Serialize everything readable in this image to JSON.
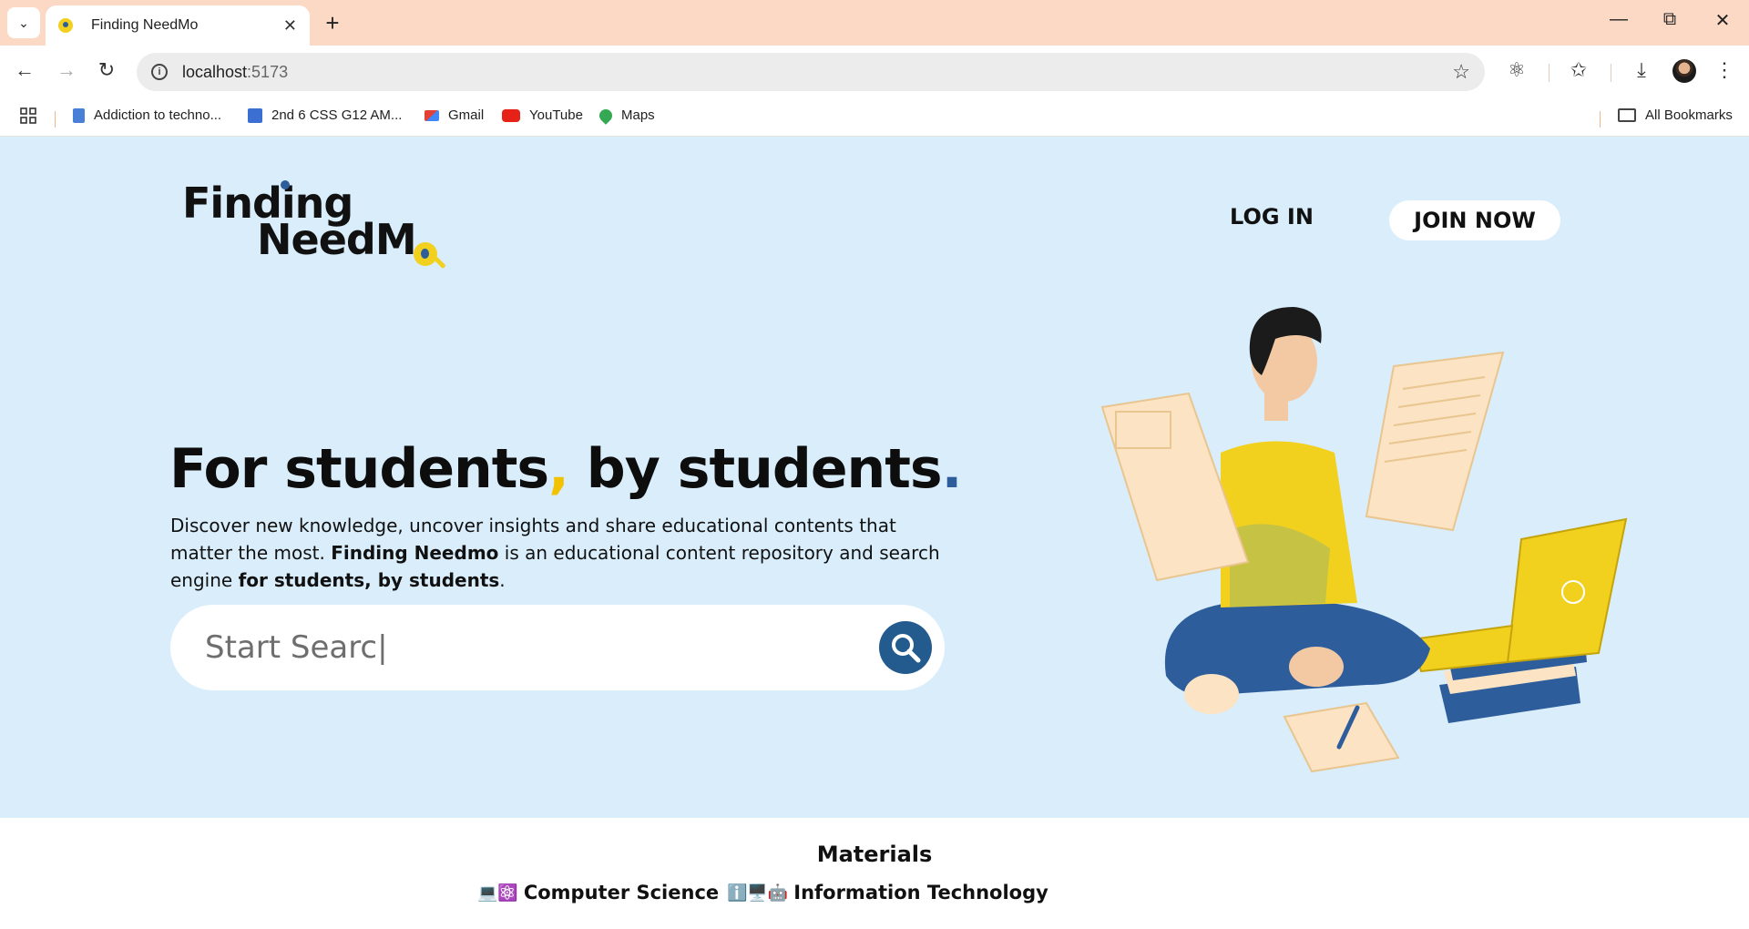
{
  "browser": {
    "tab_title": "Finding NeedMo",
    "tab_close": "✕",
    "new_tab": "+",
    "url_host": "localhost",
    "url_port": ":5173",
    "bookmarks": [
      {
        "label": "Addiction to techno...",
        "color": "#4a7fd8"
      },
      {
        "label": "2nd 6 CSS G12 AM...",
        "color": "#3b6fd1"
      },
      {
        "label": "Gmail",
        "color": "#e44134"
      },
      {
        "label": "YouTube",
        "color": "#e62117"
      },
      {
        "label": "Maps",
        "color": "#34a853"
      }
    ],
    "all_bookmarks": "All Bookmarks"
  },
  "colors": {
    "hero_bg": "#d9edfb",
    "accent_yellow": "#f2c200",
    "accent_blue": "#2e5d9c",
    "search_button": "#235b8f"
  },
  "header": {
    "logo_line1": "Finding",
    "logo_line2": "NeedM",
    "login_label": "LOG IN",
    "join_label": "JOIN NOW"
  },
  "hero": {
    "headline_part1": "For students",
    "headline_comma": ",",
    "headline_part2": " by students",
    "headline_period": ".",
    "desc_1": "Discover new knowledge, uncover insights and share educational contents that matter the most. ",
    "desc_brand": "Finding Needmo",
    "desc_2": " is an educational content repository and search engine ",
    "desc_tagline": "for students, by students",
    "desc_3": ".",
    "search_placeholder": "Start Searc|"
  },
  "materials": {
    "title": "Materials",
    "categories": [
      {
        "emoji": "💻⚛️",
        "label": "Computer Science"
      },
      {
        "emoji": "ℹ️🖥️🤖",
        "label": "Information Technology"
      }
    ]
  }
}
